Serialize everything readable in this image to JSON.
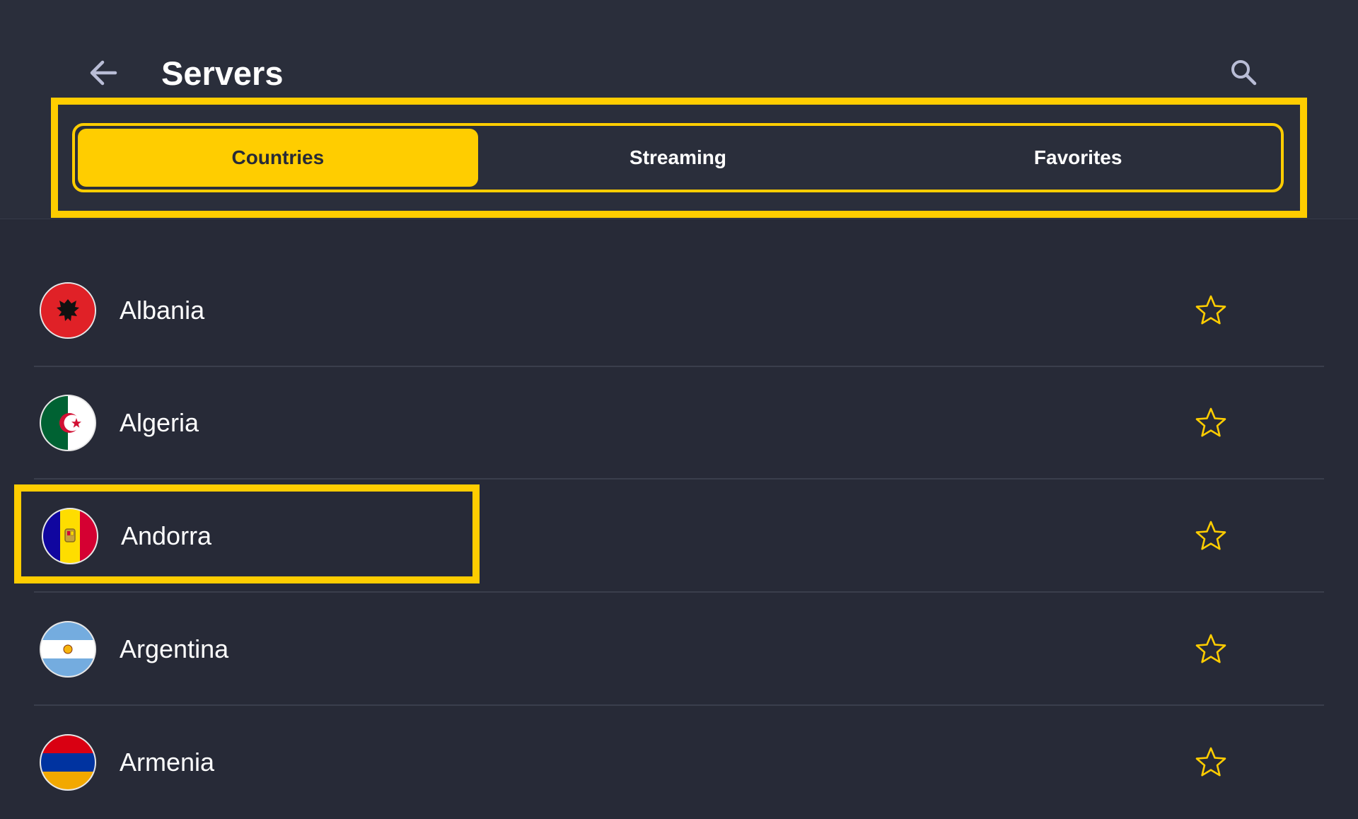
{
  "header": {
    "title": "Servers",
    "back_icon": "arrow-left-icon",
    "search_icon": "search-icon"
  },
  "tabs": [
    {
      "label": "Countries",
      "active": true
    },
    {
      "label": "Streaming",
      "active": false
    },
    {
      "label": "Favorites",
      "active": false
    }
  ],
  "countries": [
    {
      "name": "Albania",
      "flag_icon": "albania-flag-icon",
      "favorite_icon": "star-outline-icon"
    },
    {
      "name": "Algeria",
      "flag_icon": "algeria-flag-icon",
      "favorite_icon": "star-outline-icon"
    },
    {
      "name": "Andorra",
      "flag_icon": "andorra-flag-icon",
      "favorite_icon": "star-outline-icon"
    },
    {
      "name": "Argentina",
      "flag_icon": "argentina-flag-icon",
      "favorite_icon": "star-outline-icon"
    },
    {
      "name": "Armenia",
      "flag_icon": "armenia-flag-icon",
      "favorite_icon": "star-outline-icon"
    }
  ],
  "colors": {
    "background": "#272a37",
    "accent": "#ffcd00",
    "text": "#ffffff",
    "divider": "#3a3e4c"
  }
}
